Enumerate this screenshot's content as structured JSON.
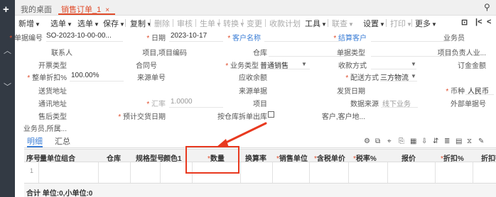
{
  "tabs": {
    "home": "我的桌面",
    "active": "销售订单_1",
    "close": "×"
  },
  "toolbar": {
    "new": "新增",
    "select_order": "选单",
    "generate": "选单",
    "save": "保存",
    "copy": "复制",
    "delete": "删除",
    "audit": "审核",
    "gen_order": "生单",
    "transfer": "转换",
    "change": "变更",
    "collection_plan": "收款计划",
    "tools": "工具",
    "query": "联查",
    "settings": "设置",
    "print": "打印",
    "more": "更多"
  },
  "form": {
    "doc_no_label": "单据编号",
    "doc_no": "SO-2023-10-00-00...",
    "date_label": "日期",
    "date": "2023-10-17",
    "customer_label": "客户名称",
    "settle_customer_label": "结算客户",
    "salesman_label": "业务员",
    "contact_label": "联系人",
    "project_code_label": "项目,项目编码",
    "warehouse_label": "仓库",
    "doc_type_label": "单据类型",
    "project_owner_label": "项目负责人业...",
    "invoice_type_label": "开票类型",
    "contract_no_label": "合同号",
    "biz_type_label": "业务类型",
    "biz_type": "普通销售",
    "receipt_method_label": "收款方式",
    "deposit_label": "订金金额",
    "discount_label": "整单折扣%",
    "discount": "100.00%",
    "source_no_label": "来源单号",
    "receivable_label": "应收余额",
    "delivery_label": "配送方式",
    "delivery": "三方物流",
    "ship_addr_label": "送货地址",
    "source_doc_label": "来源单据",
    "ship_date_label": "发货日期",
    "currency_label": "币种",
    "currency": "人民币",
    "comm_addr_label": "通讯地址",
    "rate_label": "汇率",
    "rate": "1.0000",
    "project_label": "项目",
    "data_source_label": "数据来源",
    "data_source": "线下业务",
    "external_no_label": "外部单据号",
    "after_sale_label": "售后类型",
    "expected_date_label": "预计交货日期",
    "split_label": "按仓库拆单出库",
    "customer_addr_label": "客户,客户地...",
    "salesman_dept_label": "业务员,所属..."
  },
  "detail": {
    "tab_detail": "明细",
    "tab_summary": "汇总",
    "columns": [
      "序号",
      "量单位组合",
      "仓库",
      "规格型号",
      "颜色1",
      "数量",
      "换算率",
      "销售单位",
      "含税单价",
      "税率%",
      "报价",
      "折扣%",
      "折扣额"
    ],
    "row_index": "1",
    "footer": "合计 单位:0,小单位:0"
  }
}
